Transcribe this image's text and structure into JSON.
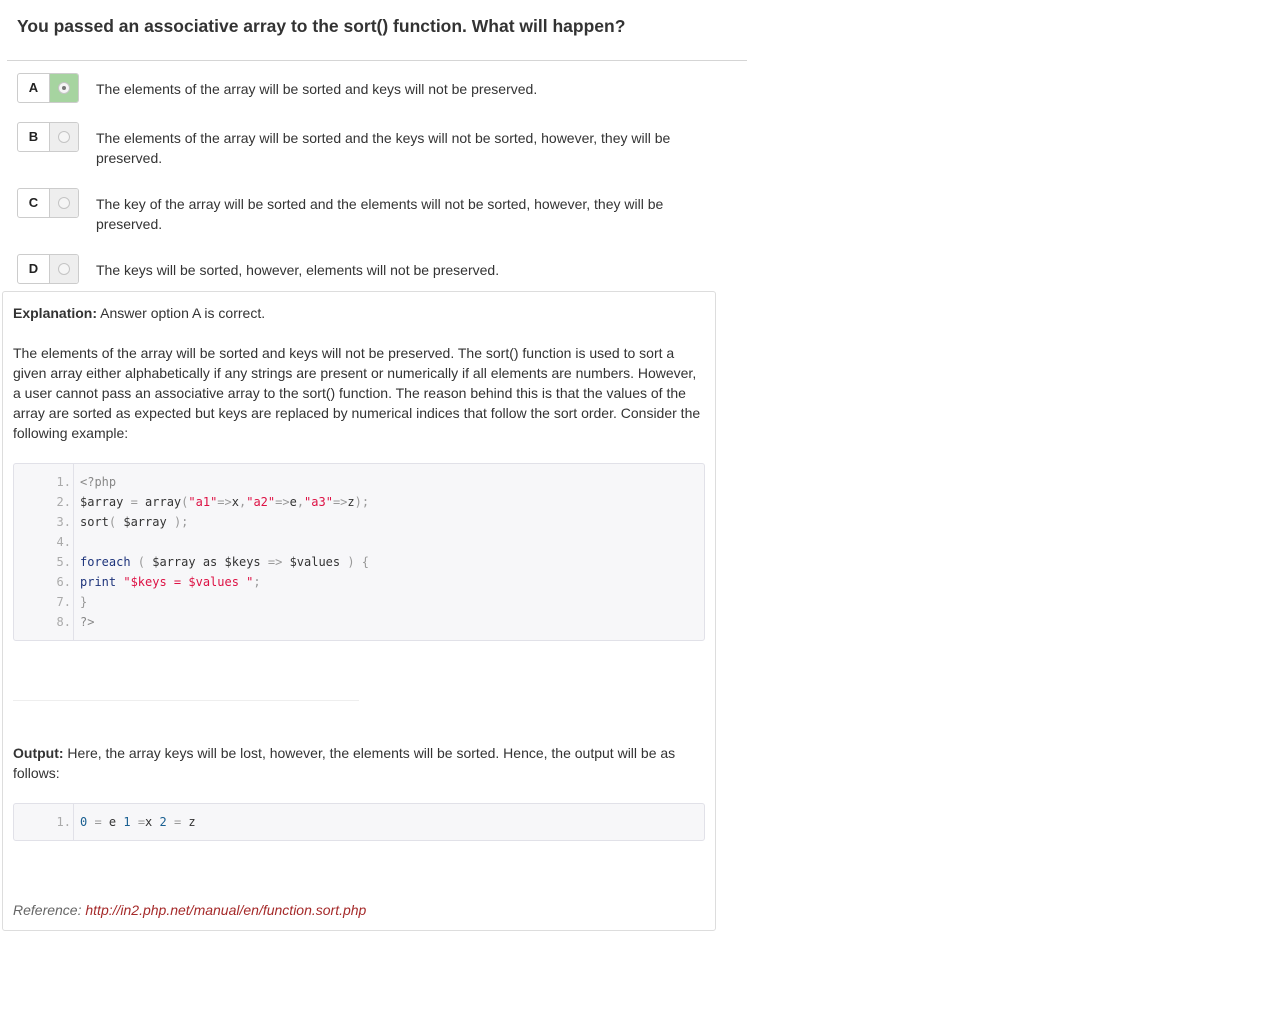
{
  "question": {
    "title": "You passed an associative array to the sort() function. What will happen?"
  },
  "options": [
    {
      "letter": "A",
      "text": "The elements of the array will be sorted and keys will not be preserved.",
      "selected": true
    },
    {
      "letter": "B",
      "text": "The elements of the array will be sorted and the keys will not be sorted, however, they will be preserved.",
      "selected": false
    },
    {
      "letter": "C",
      "text": "The key of the array will be sorted and the elements will not be sorted, however, they will be preserved.",
      "selected": false
    },
    {
      "letter": "D",
      "text": "The keys will be sorted, however, elements will not be preserved.",
      "selected": false
    }
  ],
  "explanation": {
    "label": "Explanation:",
    "summary": "Answer option A is correct.",
    "body_lines": [
      "The elements of the array will be sorted and keys will not be preserved. The sort() function is used to sort a",
      "given array either alphabetically if any strings are present or numerically if all elements are numbers. However,",
      "a user cannot pass an associative array to the sort() function. The reason behind this is that the values of the",
      "array are sorted as expected but keys are replaced by numerical indices that follow the sort order. Consider the",
      "following example:"
    ],
    "code_lines": [
      {
        "n": "1.",
        "tokens": [
          [
            "tk-grey",
            "<?php"
          ]
        ]
      },
      {
        "n": "2.",
        "tokens": [
          [
            "tk-pln",
            "$array "
          ],
          [
            "tk-pun",
            "= "
          ],
          [
            "tk-pln",
            "array"
          ],
          [
            "tk-pun",
            "("
          ],
          [
            "tk-str",
            "\"a1\""
          ],
          [
            "tk-pun",
            "=>"
          ],
          [
            "tk-pln",
            "x"
          ],
          [
            "tk-pun",
            ","
          ],
          [
            "tk-str",
            "\"a2\""
          ],
          [
            "tk-pun",
            "=>"
          ],
          [
            "tk-pln",
            "e"
          ],
          [
            "tk-pun",
            ","
          ],
          [
            "tk-str",
            "\"a3\""
          ],
          [
            "tk-pun",
            "=>"
          ],
          [
            "tk-pln",
            "z"
          ],
          [
            "tk-pun",
            ");"
          ]
        ]
      },
      {
        "n": "3.",
        "tokens": [
          [
            "tk-pln",
            "sort"
          ],
          [
            "tk-pun",
            "( "
          ],
          [
            "tk-pln",
            "$array "
          ],
          [
            "tk-pun",
            ");"
          ]
        ]
      },
      {
        "n": "4.",
        "tokens": []
      },
      {
        "n": "5.",
        "tokens": [
          [
            "tk-kwd",
            "foreach "
          ],
          [
            "tk-pun",
            "( "
          ],
          [
            "tk-pln",
            "$array "
          ],
          [
            "tk-pln",
            "as "
          ],
          [
            "tk-pln",
            "$keys "
          ],
          [
            "tk-pun",
            "=> "
          ],
          [
            "tk-pln",
            "$values "
          ],
          [
            "tk-pun",
            ") {"
          ]
        ]
      },
      {
        "n": "6.",
        "tokens": [
          [
            "tk-kwd",
            "print "
          ],
          [
            "tk-str",
            "\"$keys = $values \""
          ],
          [
            "tk-pun",
            ";"
          ]
        ]
      },
      {
        "n": "7.",
        "tokens": [
          [
            "tk-pun",
            "}"
          ]
        ]
      },
      {
        "n": "8.",
        "tokens": [
          [
            "tk-grey",
            "?>"
          ]
        ]
      }
    ]
  },
  "output": {
    "label": "Output:",
    "lines": [
      "Here, the array keys will be lost, however, the elements will be sorted. Hence, the output will be as",
      "follows:"
    ],
    "code_lines": [
      {
        "n": "1.",
        "tokens": [
          [
            "tk-lit",
            "0 "
          ],
          [
            "tk-pun",
            "= "
          ],
          [
            "tk-pln",
            "e "
          ],
          [
            "tk-lit",
            "1 "
          ],
          [
            "tk-pun",
            "="
          ],
          [
            "tk-pln",
            "x "
          ],
          [
            "tk-lit",
            "2 "
          ],
          [
            "tk-pun",
            "= "
          ],
          [
            "tk-pln",
            "z"
          ]
        ]
      }
    ]
  },
  "reference": {
    "label": "Reference:",
    "link_text": "http://in2.php.net/manual/en/function.sort.php"
  }
}
